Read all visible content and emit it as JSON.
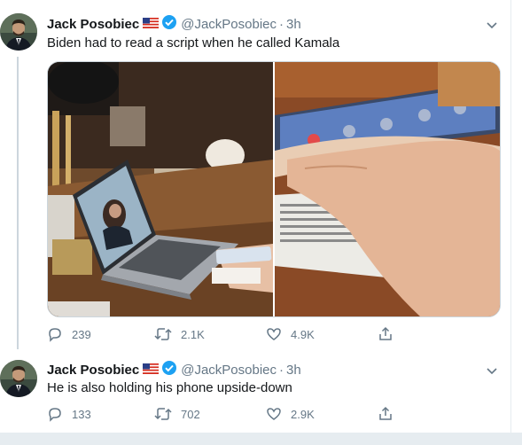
{
  "tweets": [
    {
      "name": "Jack Posobiec",
      "handle": "@JackPosobiec",
      "dot": "·",
      "time": "3h",
      "text": "Biden had to read a script when he called Kamala",
      "replies": "239",
      "retweets": "2.1K",
      "likes": "4.9K"
    },
    {
      "name": "Jack Posobiec",
      "handle": "@JackPosobiec",
      "dot": "·",
      "time": "3h",
      "text": "He is also holding his phone upside-down",
      "replies": "133",
      "retweets": "702",
      "likes": "2.9K"
    }
  ],
  "icons": {
    "reply": "reply-icon",
    "retweet": "retweet-icon",
    "like": "heart-icon",
    "share": "share-icon",
    "more": "chevron-down-icon",
    "verified": "verified-badge-icon",
    "flag": "us-flag-icon"
  },
  "colors": {
    "primary_text": "#14171a",
    "secondary_text": "#657786",
    "verified_blue": "#1da1f2",
    "border": "#e6ecf0"
  }
}
